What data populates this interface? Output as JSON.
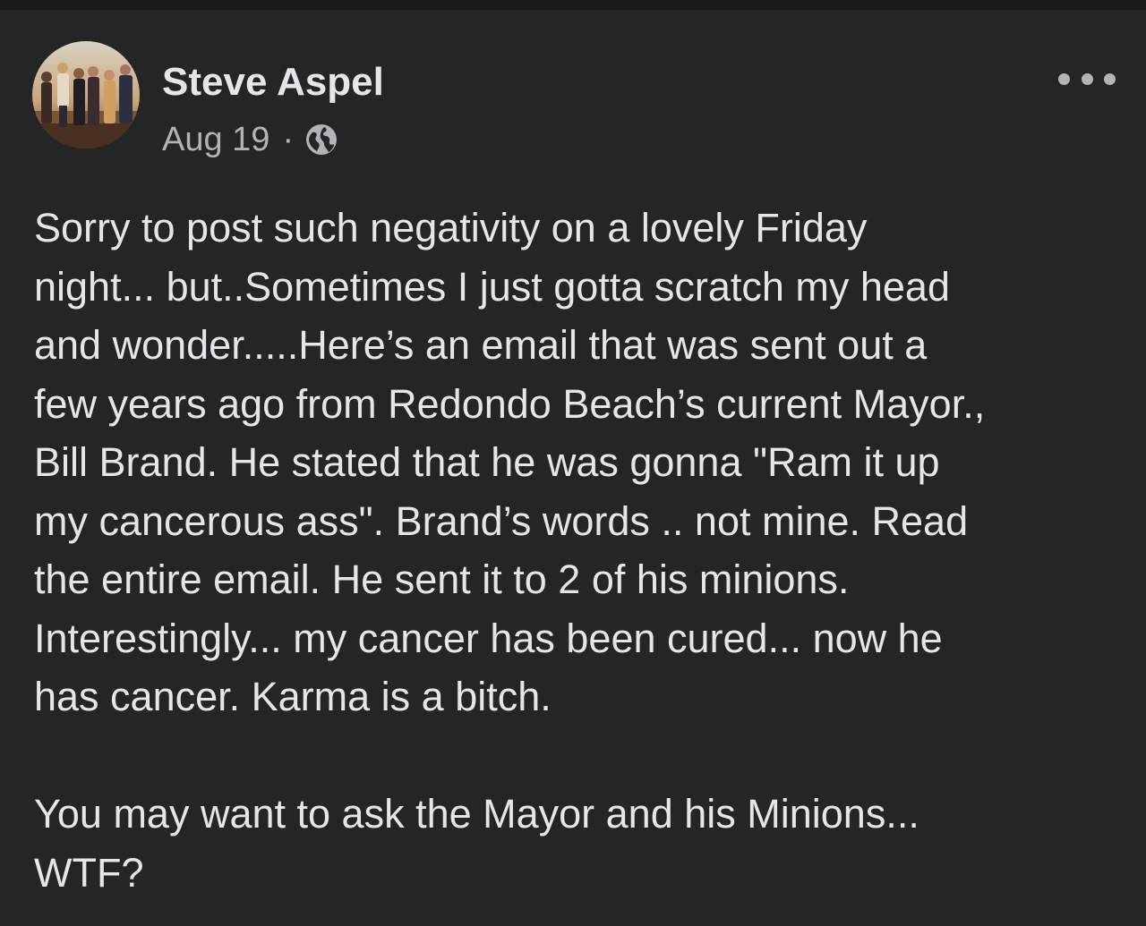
{
  "post": {
    "author": "Steve Aspel",
    "date": "Aug 19",
    "separator": "·",
    "audience_icon": "globe-icon",
    "menu_icon": "more-options-icon",
    "paragraph1_lines": [
      "Sorry to post such negativity on a lovely Friday",
      "night... but..Sometimes I just gotta scratch my head",
      "and wonder.....Here’s an email that was sent out a",
      "few years ago from Redondo Beach’s current Mayor.,",
      "Bill Brand. He stated that he was gonna \"Ram it up",
      "my cancerous ass\". Brand’s words .. not mine. Read",
      "the entire email. He sent it to 2 of his minions.",
      "Interestingly... my cancer has been cured... now he",
      "has cancer. Karma is a bitch."
    ],
    "paragraph2_lines": [
      "You may want to ask the Mayor and his Minions...",
      "WTF?"
    ]
  },
  "colors": {
    "background": "#242526",
    "top_strip": "#18191a",
    "primary_text": "#e4e6eb",
    "secondary_text": "#b0b3b8"
  }
}
